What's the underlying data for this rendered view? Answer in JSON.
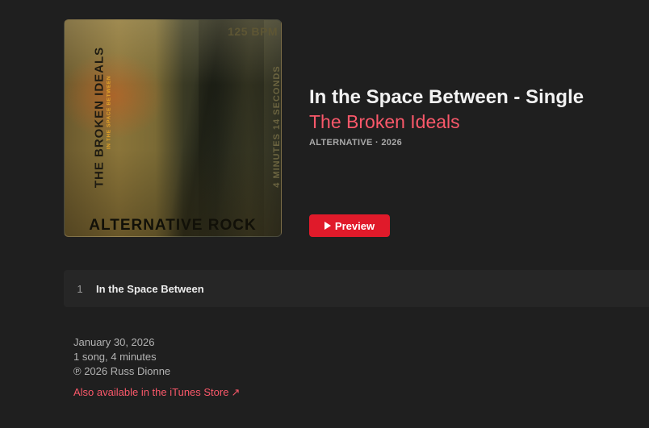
{
  "artwork": {
    "band_name": "THE BROKEN IDEALS",
    "subtitle": "IN THE SPACE BETWEEN",
    "bpm": "125 BPM",
    "duration": "4 MINUTES 14 SECONDS",
    "genre": "ALTERNATIVE ROCK"
  },
  "album": {
    "title": "In the Space Between - Single",
    "artist": "The Broken Ideals",
    "meta": "ALTERNATIVE · 2026"
  },
  "preview_button": {
    "label": "Preview",
    "icon": "play-icon",
    "color": "#e01a2a"
  },
  "tracks": [
    {
      "number": "1",
      "title": "In the Space Between"
    }
  ],
  "footer": {
    "release_date": "January 30, 2026",
    "summary": "1 song, 4 minutes",
    "copyright": "℗ 2026 Russ Dionne",
    "store_link": "Also available in the iTunes Store",
    "store_link_icon": "external-arrow-icon"
  },
  "colors": {
    "accent": "#fa586a",
    "background": "#1f1f1f"
  }
}
